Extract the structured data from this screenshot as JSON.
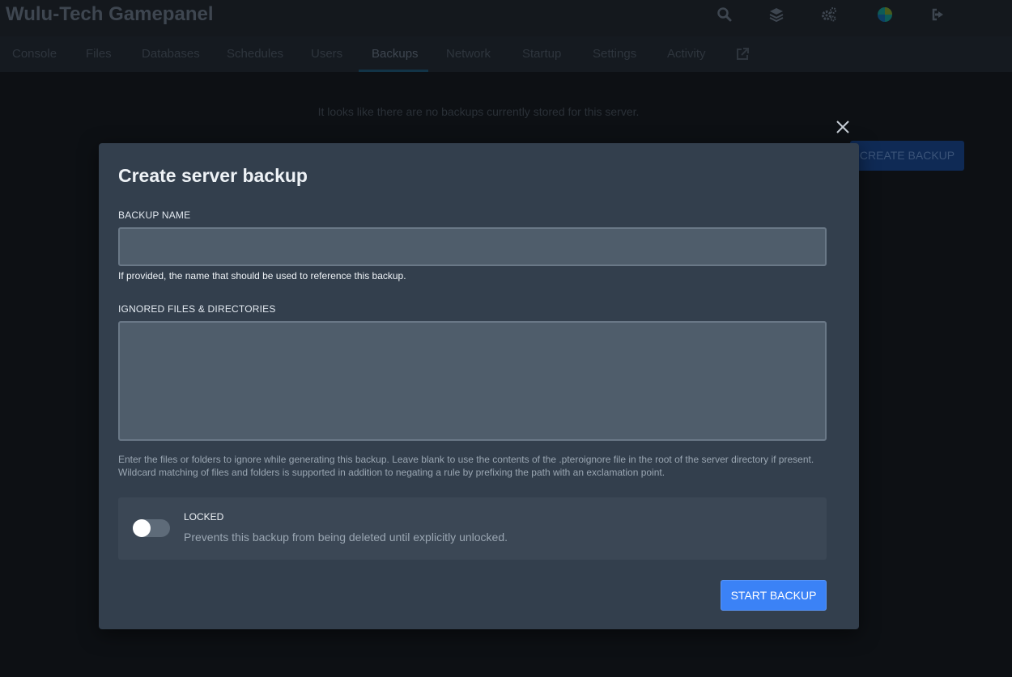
{
  "header": {
    "app_title": "Wulu-Tech Gamepanel",
    "icons": [
      "search-icon",
      "layers-icon",
      "cogs-icon",
      "avatar",
      "sign-out-icon"
    ]
  },
  "nav": {
    "items": [
      {
        "label": "Console"
      },
      {
        "label": "Files"
      },
      {
        "label": "Databases"
      },
      {
        "label": "Schedules"
      },
      {
        "label": "Users"
      },
      {
        "label": "Backups",
        "active": true
      },
      {
        "label": "Network"
      },
      {
        "label": "Startup"
      },
      {
        "label": "Settings"
      },
      {
        "label": "Activity"
      }
    ],
    "external_icon": "external-link-icon"
  },
  "page": {
    "empty_message": "It looks like there are no backups currently stored for this server.",
    "create_backup_label": "CREATE BACKUP"
  },
  "modal": {
    "title": "Create server backup",
    "backup_name_label": "BACKUP NAME",
    "backup_name_value": "",
    "backup_name_help": "If provided, the name that should be used to reference this backup.",
    "ignored_label": "IGNORED FILES & DIRECTORIES",
    "ignored_value": "",
    "ignored_help": "Enter the files or folders to ignore while generating this backup. Leave blank to use the contents of the .pteroignore file in the root of the server directory if present. Wildcard matching of files and folders is supported in addition to negating a rule by prefixing the path with an exclamation point.",
    "locked_label": "LOCKED",
    "locked_description": "Prevents this backup from being deleted until explicitly unlocked.",
    "locked_on": false,
    "start_button_label": "START BACKUP"
  },
  "colors": {
    "accent": "#3b82f6",
    "modal_bg": "#333f4d",
    "page_bg": "#0d1014"
  }
}
